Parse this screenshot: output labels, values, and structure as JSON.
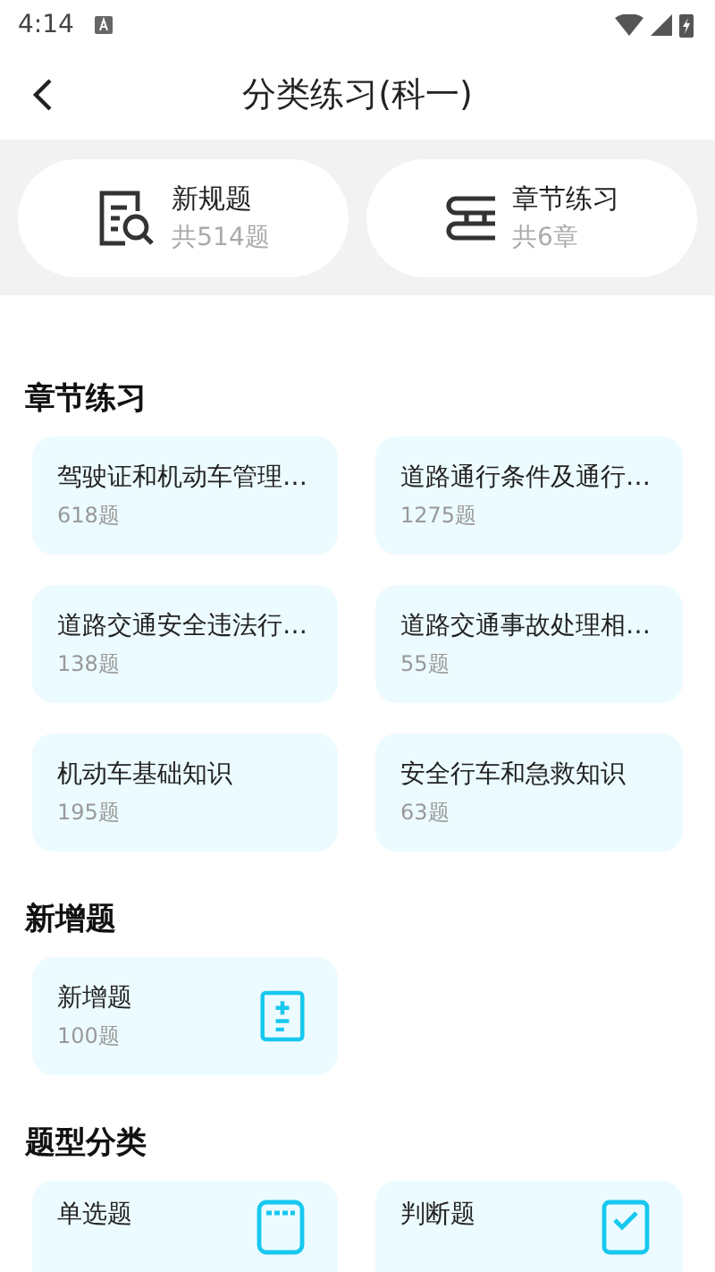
{
  "status_bar": {
    "time": "4:14"
  },
  "header": {
    "title": "分类练习(科一)"
  },
  "summary": [
    {
      "kind": "new",
      "title": "新规题",
      "count": "共514题"
    },
    {
      "kind": "chapter",
      "title": "章节练习",
      "count": "共6章"
    }
  ],
  "sections": [
    {
      "title": "章节练习",
      "cards": [
        {
          "title": "驾驶证和机动车管理…",
          "count": "618题"
        },
        {
          "title": "道路通行条件及通行…",
          "count": "1275题"
        },
        {
          "title": "道路交通安全违法行…",
          "count": "138题"
        },
        {
          "title": "道路交通事故处理相…",
          "count": "55题"
        },
        {
          "title": "机动车基础知识",
          "count": "195题"
        },
        {
          "title": "安全行车和急救知识",
          "count": "63题"
        }
      ]
    },
    {
      "title": "新增题",
      "cards": [
        {
          "title": "新增题",
          "count": "100题",
          "kind": "plusminus"
        }
      ]
    },
    {
      "title": "题型分类",
      "cards": [
        {
          "title": "单选题",
          "kind": "list"
        },
        {
          "title": "判断题",
          "kind": "check"
        }
      ]
    }
  ]
}
